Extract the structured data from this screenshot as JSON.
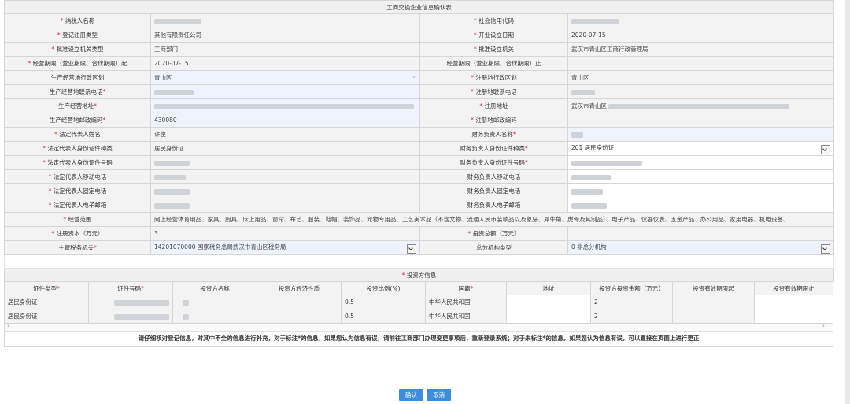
{
  "title": "工商交换企业信息确认表",
  "rows": [
    {
      "l1": "纳税人名称",
      "r1": true,
      "v1": "",
      "b1": 60,
      "l2": "社会信用代码",
      "r2": true,
      "v2": "",
      "b2": 60
    },
    {
      "l1": "登记注册类型",
      "r1": true,
      "v1": "其他有限责任公司",
      "l2": "开业设立日期",
      "r2": true,
      "v2": "2020-07-15"
    },
    {
      "l1": "批准设立机关类型",
      "r1": true,
      "v1": "工商部门",
      "l2": "批准设立机关",
      "r2": true,
      "v2": "武汉市青山区工商行政管理局"
    },
    {
      "l1": "经营期限（营业期限、合伙期限）起",
      "r1": true,
      "v1": "2020-07-15",
      "l2": "经营期限（营业期限、合伙期限）止",
      "r2": false,
      "v2": ""
    },
    {
      "l1": "生产经营地行政区划",
      "r1": false,
      "v1": "青山区",
      "edit1": true,
      "caret1": "⌄",
      "l2": "注册地行政区划",
      "r2": true,
      "v2": "青山区"
    },
    {
      "l1": "生产经营地联系电话",
      "r1": false,
      "r1post": true,
      "v1": "",
      "b1": 50,
      "edit1": true,
      "l2": "注册地联系电话",
      "r2": true,
      "v2": "",
      "b2": 30
    },
    {
      "l1": "生产经营地址",
      "r1": false,
      "r1post": true,
      "v1": "",
      "b1": 330,
      "edit1": true,
      "l2": "注册地址",
      "r2": true,
      "v2": "武汉市青山区",
      "b2": 230
    },
    {
      "l1": "生产经营地邮政编码",
      "r1": false,
      "r1post": true,
      "v1": "430080",
      "edit1": true,
      "l2": "注册地邮政编码",
      "r2": true,
      "v2": ""
    },
    {
      "l1": "法定代表人姓名",
      "r1": true,
      "v1": "许俊",
      "l2": "财务负责人名称",
      "r2": false,
      "r2post": true,
      "v2": "",
      "b2": 15,
      "edit2": true
    },
    {
      "l1": "法定代表人身份证件种类",
      "r1": true,
      "v1": "居民身份证",
      "l2": "财务负责人身份证件种类",
      "r2": false,
      "r2post": true,
      "v2": "201 居民身份证",
      "edit2w": true,
      "dd2": true
    },
    {
      "l1": "法定代表人身份证件号码",
      "r1": true,
      "v1": "",
      "b1": 45,
      "l2": "财务负责人身份证件号码",
      "r2": false,
      "r2post": true,
      "v2": "",
      "b2": 90,
      "edit2w": true
    },
    {
      "l1": "法定代表人移动电话",
      "r1": true,
      "v1": "",
      "b1": 40,
      "l2": "财务负责人移动电话",
      "r2": false,
      "v2": "",
      "b2": 50,
      "edit2w": true
    },
    {
      "l1": "法定代表人固定电话",
      "r1": true,
      "v1": "",
      "b1": 45,
      "l2": "财务负责人固定电话",
      "r2": false,
      "v2": "",
      "b2": 40,
      "edit2w": true
    },
    {
      "l1": "法定代表人电子邮箱",
      "r1": true,
      "v1": "",
      "b1": 45,
      "l2": "财务负责人电子邮箱",
      "r2": false,
      "v2": "",
      "b2": 45,
      "edit2w": true
    }
  ],
  "scope": {
    "label": "经营范围",
    "value": "网上经营体育用品、家具、厨具、床上用品、窗帘、布艺、服装、鞋帽、装饰品、宠物专用品、工艺美术品（不含文物、流通人民币装帧品以及象牙、犀牛角、虎骨及其制品）、电子产品、仪器仪表、五金产品、办公用品、家用电器、机电设备、"
  },
  "capital": {
    "label": "注册资本（万元）",
    "value": "3",
    "label2": "投资总额（万元）"
  },
  "tax": {
    "label": "主管税务机关",
    "value": "14201070000 国家税务总局武汉市青山区税务局",
    "label2": "总分机构类型",
    "value2": "0 非总分机构"
  },
  "investor": {
    "title": "投资方信息",
    "columns": [
      {
        "t": "证件类型",
        "req": true
      },
      {
        "t": "证件号码",
        "req": true
      },
      {
        "t": "投资方名称",
        "req": false
      },
      {
        "t": "投资方经济性质",
        "req": false
      },
      {
        "t": "投资比例(%)",
        "req": false
      },
      {
        "t": "国籍",
        "req": true
      },
      {
        "t": "地址",
        "req": false
      },
      {
        "t": "投资方投资金额（万元）",
        "req": false
      },
      {
        "t": "投资有效期限起",
        "req": false
      },
      {
        "t": "投资有效期限止",
        "req": false
      }
    ],
    "rows": [
      [
        "居民身份证",
        "",
        "",
        "",
        "0.5",
        "中华人民共和国",
        "",
        "2",
        "",
        ""
      ],
      [
        "居民身份证",
        "",
        "",
        "",
        "0.5",
        "中华人民共和国",
        "",
        "2",
        "",
        ""
      ]
    ]
  },
  "notice": "请仔细核对登记信息，对其中不全的信息进行补充，对于标注*的信息，如果您认为信息有误，请前往工商部门办理变更事项后，重新登录系统；对于未标注*的信息，如果您认为信息有误，可以直接在页面上进行更正",
  "buttons": {
    "confirm": "确认",
    "cancel": "取消"
  }
}
